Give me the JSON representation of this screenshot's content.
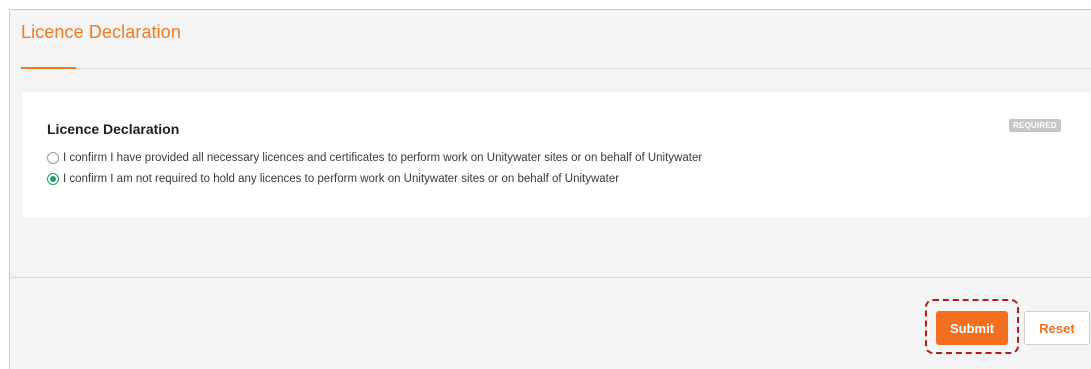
{
  "header": {
    "title": "Licence Declaration"
  },
  "card": {
    "title": "Licence Declaration",
    "badge": "REQUIRED",
    "options": [
      {
        "label": "I confirm I have provided all necessary licences and certificates to perform work on Unitywater sites or on behalf of Unitywater",
        "selected": false
      },
      {
        "label": "I confirm I am not required to hold any licences to perform work on Unitywater sites or on behalf of Unitywater",
        "selected": true
      }
    ]
  },
  "actions": {
    "submit_label": "Submit",
    "reset_label": "Reset"
  },
  "colors": {
    "accent": "#f47920",
    "radio_selected": "#1e9e68",
    "highlight": "#b01c1c"
  }
}
